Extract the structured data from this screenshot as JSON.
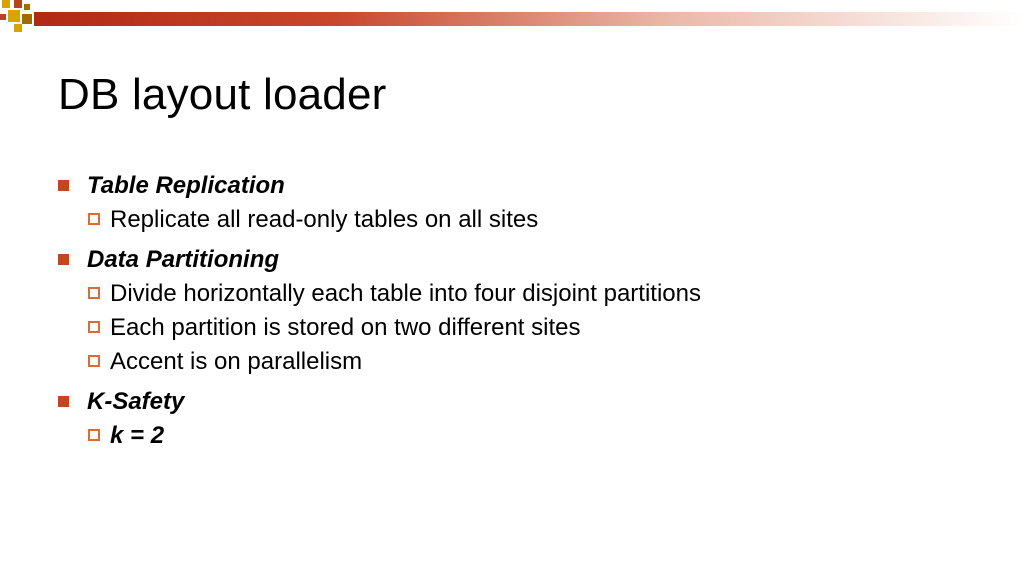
{
  "title": "DB layout loader",
  "items": [
    {
      "label": "Table Replication",
      "sub": [
        "Replicate all read-only tables on all sites"
      ]
    },
    {
      "label": "Data Partitioning",
      "sub": [
        "Divide horizontally each table into four disjoint partitions",
        "Each partition is stored on two different sites",
        "Accent is on parallelism"
      ]
    },
    {
      "label": "K-Safety",
      "sub": [
        "k = 2"
      ]
    }
  ]
}
